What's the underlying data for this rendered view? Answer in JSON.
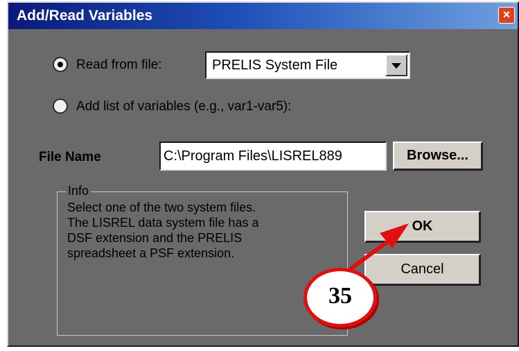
{
  "window": {
    "title": "Add/Read Variables",
    "close_glyph": "×"
  },
  "options": {
    "read_from_file": {
      "label": "Read from file:",
      "selected": true
    },
    "add_list": {
      "label": "Add list of variables (e.g., var1-var5):",
      "selected": false
    }
  },
  "file_type_select": {
    "value": "PRELIS System File"
  },
  "file_name": {
    "label": "File Name",
    "value": "C:\\Program Files\\LISREL889"
  },
  "buttons": {
    "browse": "Browse...",
    "ok": "OK",
    "cancel": "Cancel"
  },
  "info": {
    "legend": "Info",
    "lines": [
      "Select one of the two system files.",
      "The LISREL data system file has a",
      "DSF extension and the PRELIS",
      "spreadsheet a PSF extension."
    ]
  },
  "annotation": {
    "number": "35",
    "color": "#e01010"
  },
  "colors": {
    "dialog_bg": "#6a6a6a",
    "title_start": "#0a1a7a",
    "title_end": "#6fa0e0",
    "button_face": "#d4d0c8"
  },
  "icons": {
    "close": "close-icon",
    "dropdown": "chevron-down-icon"
  }
}
